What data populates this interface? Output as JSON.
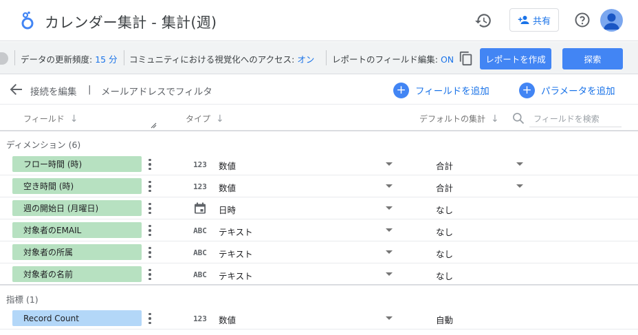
{
  "header": {
    "title": "カレンダー集計 - 集計(週)",
    "share_label": "共有",
    "icons": [
      "history-icon",
      "add-person-icon",
      "help-icon",
      "avatar-icon"
    ]
  },
  "toolbar": {
    "freshness_label": "データの更新頻度:",
    "freshness_value": "15 分",
    "community_label": "コミュニティにおける視覚化へのアクセス:",
    "community_value": "オン",
    "field_edit_label": "レポートのフィールド編集:",
    "field_edit_value": "ON",
    "create_report_label": "レポートを作成",
    "explore_label": "探索"
  },
  "subbar": {
    "edit_connection": "接続を編集",
    "separator": "|",
    "filter_by_email": "メールアドレスでフィルタ",
    "add_field": "フィールドを追加",
    "add_parameter": "パラメータを追加"
  },
  "columns": {
    "field": "フィールド",
    "type": "タイプ",
    "default_aggregation": "デフォルトの集計",
    "search_placeholder": "フィールドを検索"
  },
  "dimensions": {
    "title": "ディメンション (6)",
    "rows": [
      {
        "name": "フロー時間 (時)",
        "type_icon": "123",
        "type": "数値",
        "aggregation": "合計",
        "agg_dropdown": true
      },
      {
        "name": "空き時間 (時)",
        "type_icon": "123",
        "type": "数値",
        "aggregation": "合計",
        "agg_dropdown": true
      },
      {
        "name": "週の開始日 (月曜日)",
        "type_icon": "calendar-icon",
        "type": "日時",
        "aggregation": "なし",
        "agg_dropdown": false
      },
      {
        "name": "対象者のEMAIL",
        "type_icon": "ABC",
        "type": "テキスト",
        "aggregation": "なし",
        "agg_dropdown": false
      },
      {
        "name": "対象者の所属",
        "type_icon": "ABC",
        "type": "テキスト",
        "aggregation": "なし",
        "agg_dropdown": false
      },
      {
        "name": "対象者の名前",
        "type_icon": "ABC",
        "type": "テキスト",
        "aggregation": "なし",
        "agg_dropdown": false
      }
    ]
  },
  "metrics": {
    "title": "指標 (1)",
    "rows": [
      {
        "name": "Record Count",
        "type_icon": "123",
        "type": "数値",
        "aggregation": "自動",
        "agg_dropdown": false
      }
    ]
  },
  "colors": {
    "accent": "#4285f4",
    "link": "#1a73e8",
    "dimension_chip": "#b7e1c1",
    "metric_chip": "#b3d7f8"
  }
}
